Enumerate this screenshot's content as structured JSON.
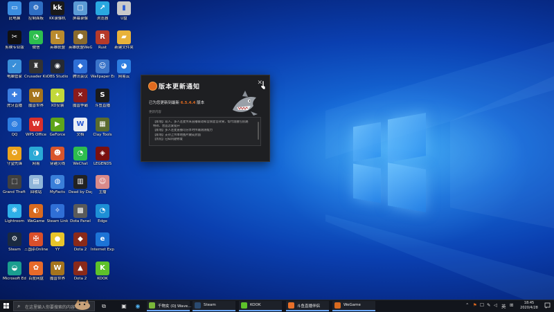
{
  "desktop": {
    "icons": [
      {
        "label": "此电脑",
        "glyph": "▭",
        "color": "#3b8de0"
      },
      {
        "label": "控制面板",
        "glyph": "⚙",
        "color": "#2f6fc4"
      },
      {
        "label": "KK录像机",
        "glyph": "kk",
        "color": "#1a1a1a"
      },
      {
        "label": "屏幕录像",
        "glyph": "▢",
        "color": "#5b9bd5"
      },
      {
        "label": "浏览器",
        "glyph": "↗",
        "color": "#29a8e0"
      },
      {
        "label": "U盘",
        "glyph": "▮",
        "color": "#c9c9c9"
      },
      {
        "label": "剪映专业版",
        "glyph": "✂",
        "color": "#111111"
      },
      {
        "label": "微信",
        "glyph": "◔",
        "color": "#2dbe4e"
      },
      {
        "label": "英雄联盟",
        "glyph": "L",
        "color": "#b98a2e"
      },
      {
        "label": "英雄联盟WeGame版",
        "glyph": "⬢",
        "color": "#8a6b2e"
      },
      {
        "label": "Rust",
        "glyph": "R",
        "color": "#b53a2a"
      },
      {
        "label": "新建文件夹",
        "glyph": "▰",
        "color": "#e8b23a"
      },
      {
        "label": "电脑管家",
        "glyph": "✓",
        "color": "#3a8fd9"
      },
      {
        "label": "Crusader Kings",
        "glyph": "♜",
        "color": "#333333"
      },
      {
        "label": "OBS Studio",
        "glyph": "◉",
        "color": "#262a33"
      },
      {
        "label": "腾讯会议",
        "glyph": "◆",
        "color": "#2f6fd6"
      },
      {
        "label": "Wallpaper Engine",
        "glyph": "☺",
        "color": "#3a74c9"
      },
      {
        "label": "网易云",
        "glyph": "◕",
        "color": "#2d7de0"
      },
      {
        "label": "虎牙直播",
        "glyph": "✚",
        "color": "#3b7ee0"
      },
      {
        "label": "魔兽世界",
        "glyph": "W",
        "color": "#a5741d"
      },
      {
        "label": "XD安装",
        "glyph": "✦",
        "color": "#c2d83a"
      },
      {
        "label": "魔兽争霸",
        "glyph": "✕",
        "color": "#8b1b1b"
      },
      {
        "label": "斗鱼直播",
        "glyph": "S",
        "color": "#1a1a1a"
      },
      {
        "label": "",
        "glyph": "",
        "color": ""
      },
      {
        "label": "QQ",
        "glyph": "◎",
        "color": "#2d7de0"
      },
      {
        "label": "WPS Office",
        "glyph": "W",
        "color": "#d9302c"
      },
      {
        "label": "GeForce",
        "glyph": "▶",
        "color": "#5fa51b"
      },
      {
        "label": "文档",
        "glyph": "W",
        "color": "#e9eef5"
      },
      {
        "label": "Clay Tools",
        "glyph": "▦",
        "color": "#5a6b2f"
      },
      {
        "label": "",
        "glyph": "",
        "color": ""
      },
      {
        "label": "守望先锋",
        "glyph": "✪",
        "color": "#e9a21d"
      },
      {
        "label": "网易",
        "glyph": "◑",
        "color": "#2aa9d6"
      },
      {
        "label": "穿越火线",
        "glyph": "☻",
        "color": "#d9552c"
      },
      {
        "label": "WeChat",
        "glyph": "◔",
        "color": "#2dbe4e"
      },
      {
        "label": "LEGENDS",
        "glyph": "◈",
        "color": "#7a1010"
      },
      {
        "label": "",
        "glyph": "",
        "color": ""
      },
      {
        "label": "Grand Theft Auto",
        "glyph": "⬚",
        "color": "#404040"
      },
      {
        "label": "回收站",
        "glyph": "▤",
        "color": "#8fb5d9"
      },
      {
        "label": "MyFacts",
        "glyph": "◍",
        "color": "#3a7fd9"
      },
      {
        "label": "Dead by Daylight",
        "glyph": "▥",
        "color": "#222222"
      },
      {
        "label": "主播",
        "glyph": "☺",
        "color": "#d98a8a"
      },
      {
        "label": "",
        "glyph": "",
        "color": ""
      },
      {
        "label": "Lightroom",
        "glyph": "❋",
        "color": "#2fb0e8"
      },
      {
        "label": "WeGame",
        "glyph": "◐",
        "color": "#d96a1f"
      },
      {
        "label": "Steam Link",
        "glyph": "✧",
        "color": "#2f6fd6"
      },
      {
        "label": "Dota Panel",
        "glyph": "▩",
        "color": "#5a5a5a"
      },
      {
        "label": "Edge",
        "glyph": "◔",
        "color": "#1d8fd6"
      },
      {
        "label": "",
        "glyph": "",
        "color": ""
      },
      {
        "label": "Steam",
        "glyph": "⚙",
        "color": "#1b2a40"
      },
      {
        "label": "三国杀Online",
        "glyph": "✠",
        "color": "#d94f2a"
      },
      {
        "label": "YY",
        "glyph": "●",
        "color": "#e8c52a"
      },
      {
        "label": "Dota 2",
        "glyph": "◆",
        "color": "#8a2a1a"
      },
      {
        "label": "Internet Explorer",
        "glyph": "e",
        "color": "#1d74d6"
      },
      {
        "label": "",
        "glyph": "",
        "color": ""
      },
      {
        "label": "Microsoft Edge",
        "glyph": "◒",
        "color": "#1a9e8f"
      },
      {
        "label": "百度网盘",
        "glyph": "✿",
        "color": "#e86a2a"
      },
      {
        "label": "魔兽世界",
        "glyph": "W",
        "color": "#a5741d"
      },
      {
        "label": "Dota 2",
        "glyph": "▲",
        "color": "#8a2a1a"
      },
      {
        "label": "KOOK",
        "glyph": "K",
        "color": "#5ec22a"
      },
      {
        "label": "",
        "glyph": "",
        "color": ""
      }
    ]
  },
  "dialog": {
    "title": "版本更新通知",
    "close_glyph": "✕",
    "update_prefix": "已为您更新到最新",
    "version": "6.5.4.4",
    "update_suffix": "版本",
    "section_label": "更新内容",
    "items": [
      "【新增】双人、多人连麦传来直播联动和音频混音效果，帮代理腰包别路",
      "特效、营造恋爱提升",
      "【新增】多人连麦直播可分享时传输测测能力",
      "【新增】支持上传本地图片做成封面",
      "【优化】已知问题修复"
    ]
  },
  "taskbar": {
    "search_placeholder": "在这里输入你要搜索的内容",
    "apps": [
      {
        "label": "千物女 (DJ Wave...",
        "color": "#7ab83a"
      },
      {
        "label": "Steam",
        "color": "#2a4a70"
      },
      {
        "label": "KOOK",
        "color": "#5ec22a"
      },
      {
        "label": "斗鱼直播伴侣",
        "color": "#e8702a"
      },
      {
        "label": "WeGame",
        "color": "#d96a1f"
      }
    ],
    "ime": "英",
    "time": "18:45",
    "date": "2020/4/28"
  },
  "colors": {
    "accent": "#e06a1f",
    "taskbar": "#12151c"
  }
}
